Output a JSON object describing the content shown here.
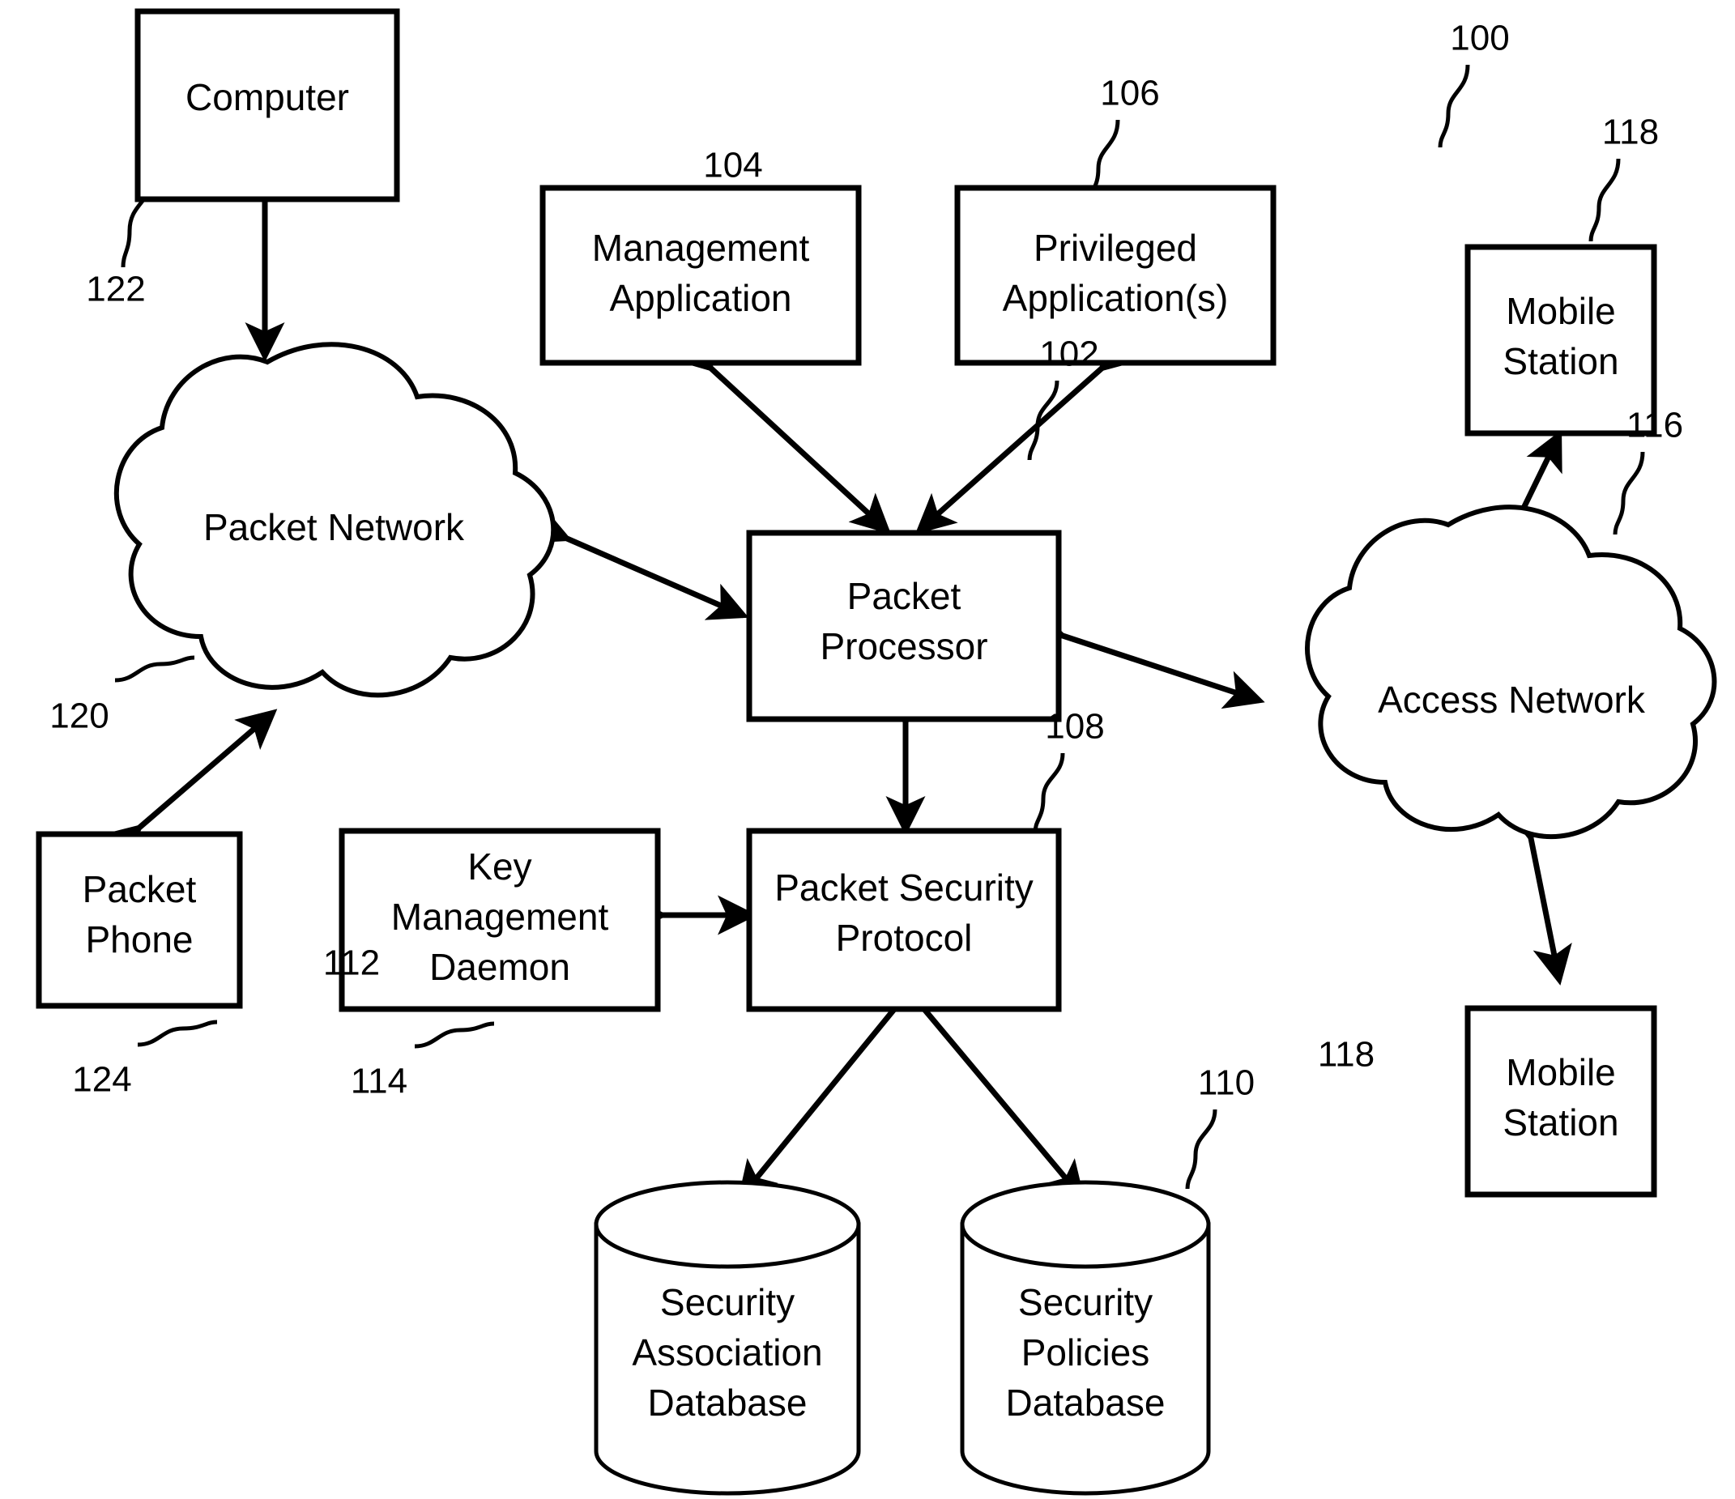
{
  "figure": {
    "type": "patent-block-diagram",
    "system_reference": "100"
  },
  "nodes": {
    "computer": {
      "label": "Computer",
      "ref": "122"
    },
    "management_application": {
      "label_line1": "Management",
      "label_line2": "Application",
      "ref": "104"
    },
    "privileged_application": {
      "label_line1": "Privileged",
      "label_line2": "Application(s)",
      "ref": "106"
    },
    "mobile_station_top": {
      "label_line1": "Mobile",
      "label_line2": "Station",
      "ref": "118"
    },
    "mobile_station_bottom": {
      "label_line1": "Mobile",
      "label_line2": "Station",
      "ref": "118"
    },
    "packet_network": {
      "label": "Packet Network",
      "ref": "120"
    },
    "access_network": {
      "label": "Access Network",
      "ref": "116"
    },
    "packet_processor": {
      "label_line1": "Packet",
      "label_line2": "Processor",
      "ref": "102"
    },
    "packet_security_protocol": {
      "label_line1": "Packet Security",
      "label_line2": "Protocol",
      "ref": "108"
    },
    "key_management_daemon": {
      "label_line1": "Key",
      "label_line2": "Management",
      "label_line3": "Daemon",
      "ref": "114"
    },
    "packet_phone": {
      "label_line1": "Packet",
      "label_line2": "Phone",
      "ref": "124"
    },
    "security_association_database": {
      "label_line1": "Security",
      "label_line2": "Association",
      "label_line3": "Database",
      "ref": "112"
    },
    "security_policies_database": {
      "label_line1": "Security",
      "label_line2": "Policies",
      "label_line3": "Database",
      "ref": "110"
    }
  },
  "connections": [
    {
      "from": "computer",
      "to": "packet_network",
      "arrows": "both"
    },
    {
      "from": "packet_phone",
      "to": "packet_network",
      "arrows": "both"
    },
    {
      "from": "packet_network",
      "to": "packet_processor",
      "arrows": "both"
    },
    {
      "from": "management_application",
      "to": "packet_processor",
      "arrows": "both"
    },
    {
      "from": "privileged_application",
      "to": "packet_processor",
      "arrows": "both"
    },
    {
      "from": "packet_processor",
      "to": "access_network",
      "arrows": "both"
    },
    {
      "from": "access_network",
      "to": "mobile_station_top",
      "arrows": "both"
    },
    {
      "from": "access_network",
      "to": "mobile_station_bottom",
      "arrows": "both"
    },
    {
      "from": "packet_processor",
      "to": "packet_security_protocol",
      "arrows": "both"
    },
    {
      "from": "key_management_daemon",
      "to": "packet_security_protocol",
      "arrows": "both"
    },
    {
      "from": "packet_security_protocol",
      "to": "security_association_database",
      "arrows": "both"
    },
    {
      "from": "packet_security_protocol",
      "to": "security_policies_database",
      "arrows": "both"
    }
  ],
  "colors": {
    "ink": "#000000",
    "paper": "#ffffff"
  }
}
